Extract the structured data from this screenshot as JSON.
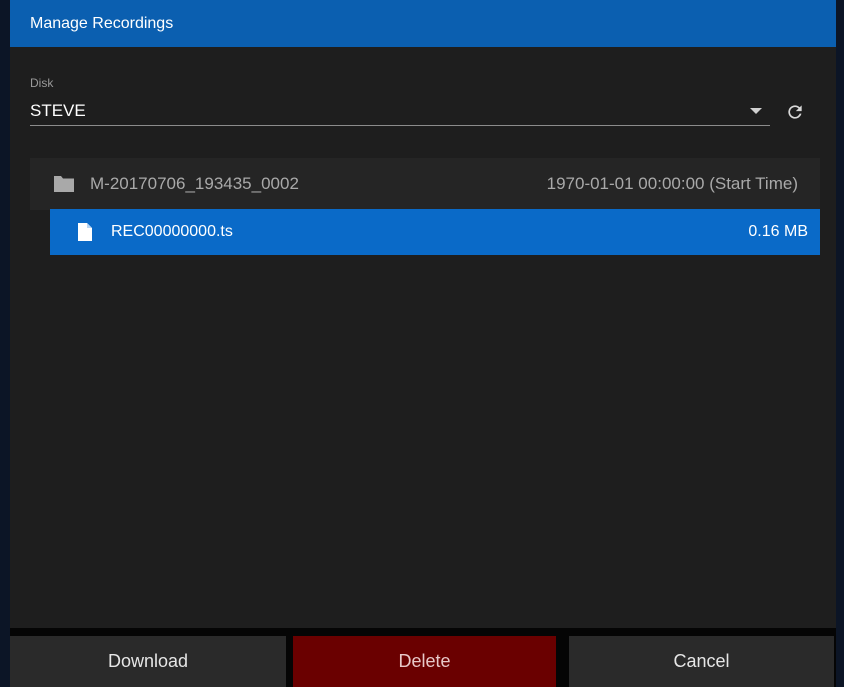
{
  "dialog": {
    "title": "Manage Recordings"
  },
  "disk": {
    "label": "Disk",
    "value": "STEVE",
    "dropdown_icon": "caret-down-icon",
    "refresh_icon": "refresh-icon"
  },
  "recordings": {
    "folder": {
      "icon": "folder-icon",
      "name": "M-20170706_193435_0002",
      "start_time": "1970-01-01 00:00:00 (Start Time)"
    },
    "files": [
      {
        "icon": "file-icon",
        "name": "REC00000000.ts",
        "size": "0.16 MB",
        "selected": true
      }
    ]
  },
  "footer": {
    "download_label": "Download",
    "delete_label": "Delete",
    "cancel_label": "Cancel"
  },
  "colors": {
    "title_bar": "#0b5fb0",
    "selected_row": "#0a6ac8",
    "delete_button": "#6a0000",
    "dialog_background": "#1e1e1e"
  }
}
